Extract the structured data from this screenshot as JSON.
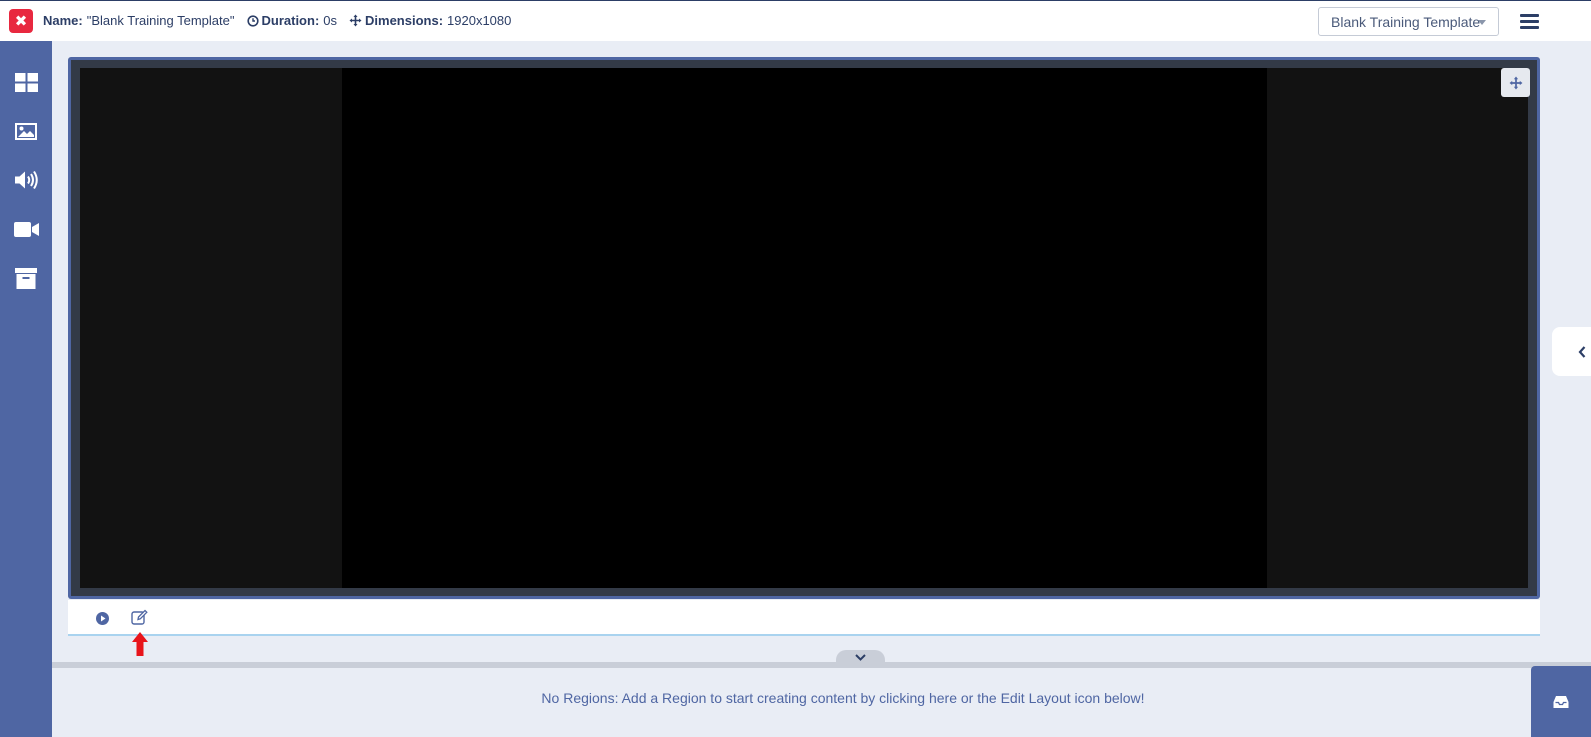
{
  "header": {
    "name_label": "Name:",
    "name_value": "\"Blank Training Template\"",
    "duration_label": "Duration:",
    "duration_value": "0s",
    "dimensions_label": "Dimensions:",
    "dimensions_value": "1920x1080",
    "template_select": "Blank Training Template"
  },
  "sidebar": {
    "items": [
      {
        "icon": "layout-grid-icon"
      },
      {
        "icon": "image-icon"
      },
      {
        "icon": "audio-icon"
      },
      {
        "icon": "video-icon"
      },
      {
        "icon": "archive-icon"
      }
    ]
  },
  "timeline": {
    "message": "No Regions: Add a Region to start creating content by clicking here or the Edit Layout icon below!"
  },
  "colors": {
    "accent": "#4f66a3",
    "close": "#e8283f",
    "text": "#2c3e66",
    "annotation_arrow": "#e8151b"
  }
}
